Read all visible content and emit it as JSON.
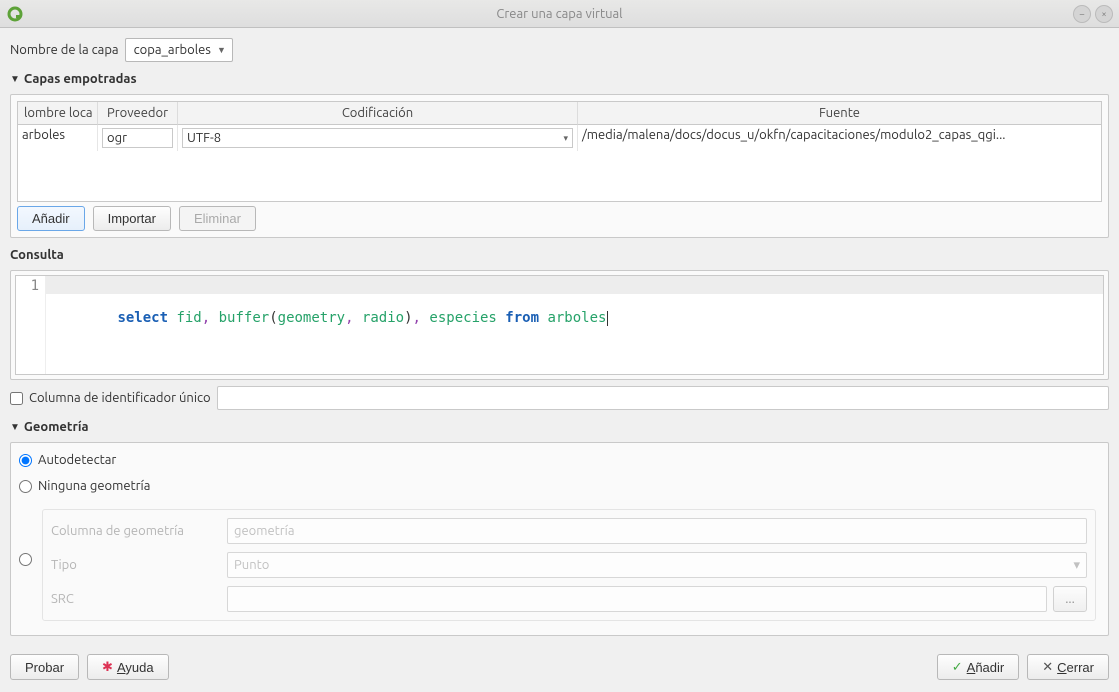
{
  "window": {
    "title": "Crear una capa virtual"
  },
  "layerName": {
    "label": "Nombre de la capa",
    "value": "copa_arboles"
  },
  "sections": {
    "embedded": "Capas empotradas",
    "query": "Consulta",
    "geometry": "Geometría"
  },
  "table": {
    "headers": {
      "name": "lombre loca",
      "provider": "Proveedor",
      "encoding": "Codificación",
      "source": "Fuente"
    },
    "rows": [
      {
        "name": "arboles",
        "provider": "ogr",
        "encoding": "UTF-8",
        "source": "/media/malena/docs/docus_u/okfn/capacitaciones/modulo2_capas_qgi..."
      }
    ]
  },
  "buttons": {
    "add": "Añadir",
    "import": "Importar",
    "delete": "Eliminar",
    "test": "Probar",
    "help": "Ayuda",
    "addFooter": "Añadir",
    "close": "Cerrar"
  },
  "query": {
    "lineNo": "1",
    "tokens": {
      "select": "select",
      "fid": "fid",
      "buffer": "buffer",
      "geometry": "geometry",
      "radio": "radio",
      "especies": "especies",
      "from": "from",
      "arboles": "arboles"
    }
  },
  "uidCol": {
    "label": "Columna de identificador único"
  },
  "geometry": {
    "autodetect": "Autodetectar",
    "none": "Ninguna geometría",
    "colLabel": "Columna de geometría",
    "colPlaceholder": "geometría",
    "typeLabel": "Tipo",
    "typeValue": "Punto",
    "crsLabel": "SRC",
    "dots": "..."
  }
}
